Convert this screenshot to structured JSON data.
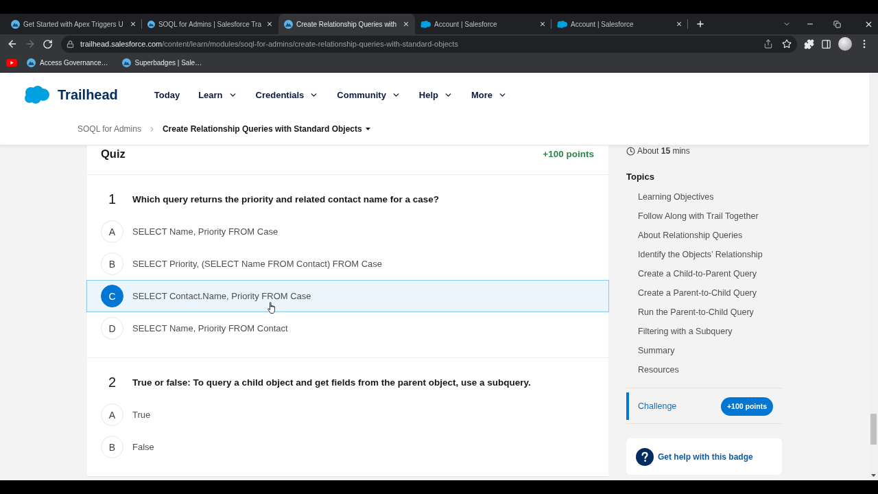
{
  "browser": {
    "tabs": [
      {
        "kind": "trailhead",
        "title": "Get Started with Apex Triggers U",
        "selected": false
      },
      {
        "kind": "trailhead",
        "title": "SOQL for Admins | Salesforce Tra",
        "selected": false
      },
      {
        "kind": "trailhead",
        "title": "Create Relationship Queries with",
        "selected": true
      },
      {
        "kind": "salesforce",
        "title": "Account | Salesforce",
        "selected": false
      },
      {
        "kind": "salesforce",
        "title": "Account | Salesforce",
        "selected": false
      }
    ],
    "forward_button": {
      "disabled": true
    },
    "address": {
      "host": "trailhead.salesforce.com",
      "path": "/content/learn/modules/soql-for-admins/create-relationship-queries-with-standard-objects"
    },
    "bookmarks": [
      {
        "kind": "video"
      },
      {
        "kind": "trailhead",
        "label": "Access Governance…"
      },
      {
        "kind": "trailhead",
        "label": "Superbadges | Sale…"
      }
    ]
  },
  "header": {
    "logo": "Trailhead",
    "nav": [
      {
        "label": "Today",
        "dropdown": false
      },
      {
        "label": "Learn",
        "dropdown": true
      },
      {
        "label": "Credentials",
        "dropdown": true
      },
      {
        "label": "Community",
        "dropdown": true
      },
      {
        "label": "Help",
        "dropdown": true
      },
      {
        "label": "More",
        "dropdown": true
      }
    ]
  },
  "breadcrumb": {
    "parent": "SOQL for Admins",
    "current": "Create Relationship Queries with Standard Objects"
  },
  "quiz": {
    "title": "Quiz",
    "points": "+100 points",
    "questions": [
      {
        "number": "1",
        "text": "Which query returns the priority and related contact name for a case?",
        "options": [
          {
            "letter": "A",
            "text": "SELECT Name, Priority FROM Case",
            "selected": false
          },
          {
            "letter": "B",
            "text": "SELECT Priority, (SELECT Name FROM Contact) FROM Case",
            "selected": false
          },
          {
            "letter": "C",
            "text": "SELECT Contact.Name, Priority FROM Case",
            "selected": true
          },
          {
            "letter": "D",
            "text": "SELECT Name, Priority FROM Contact",
            "selected": false
          }
        ]
      },
      {
        "number": "2",
        "text": "True or false: To query a child object and get fields from the parent object, use a subquery.",
        "options": [
          {
            "letter": "A",
            "text": "True",
            "selected": false
          },
          {
            "letter": "B",
            "text": "False",
            "selected": false
          }
        ]
      }
    ]
  },
  "sidebar": {
    "duration": "About **15** mins",
    "topics_title": "Topics",
    "topics": [
      {
        "label": "Learning Objectives",
        "selected": false
      },
      {
        "label": "Follow Along with Trail Together",
        "selected": false
      },
      {
        "label": "About Relationship Queries",
        "selected": false
      },
      {
        "label": "Identify the Objects’ Relationship",
        "selected": false
      },
      {
        "label": "Create a Child-to-Parent Query",
        "selected": false
      },
      {
        "label": "Create a Parent-to-Child Query",
        "selected": false
      },
      {
        "label": "Run the Parent-to-Child Query",
        "selected": false
      },
      {
        "label": "Filtering with a Subquery",
        "selected": false
      },
      {
        "label": "Summary",
        "selected": false
      },
      {
        "label": "Resources",
        "selected": false
      }
    ],
    "challenge": {
      "label": "Challenge",
      "points": "+100 points",
      "selected": true
    },
    "help": "Get help with this badge"
  }
}
